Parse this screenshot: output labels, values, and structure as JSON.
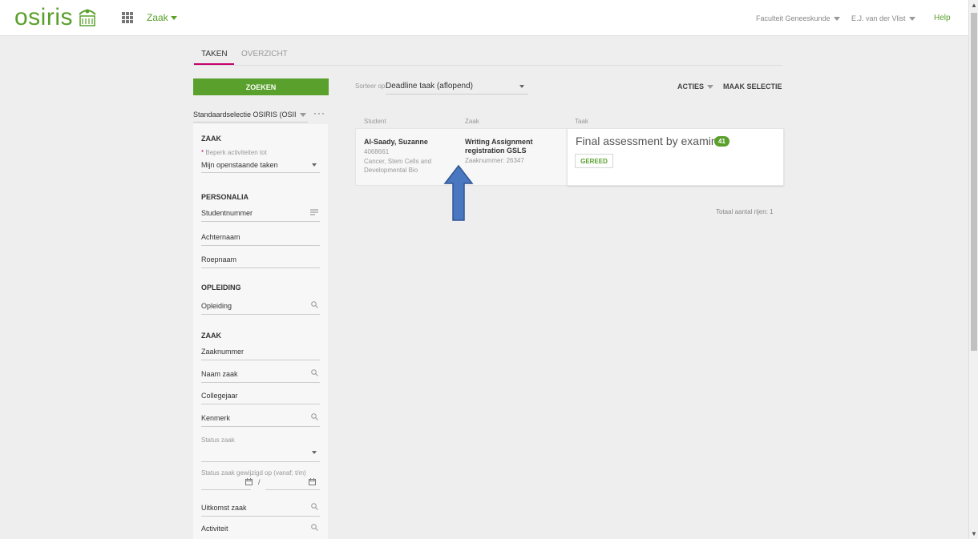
{
  "header": {
    "logo_text": "osiris",
    "menu_label": "Zaak",
    "faculty": "Faculteit Geneeskunde",
    "user": "E.J. van der Vlist",
    "help": "Help"
  },
  "tabs": [
    {
      "label": "TAKEN",
      "active": true
    },
    {
      "label": "OVERZICHT",
      "active": false
    }
  ],
  "sidebar": {
    "search_button": "ZOEKEN",
    "selection": "Standaardselectie OSIRIS (OSII",
    "more": "···",
    "zaak_section": "ZAAK",
    "limit_label": "Beperk activiteiten tot",
    "limit_required": "*",
    "limit_value": "Mijn openstaande taken",
    "personalia_section": "PERSONALIA",
    "studentnummer": "Studentnummer",
    "achternaam": "Achternaam",
    "roepnaam": "Roepnaam",
    "opleiding_section": "OPLEIDING",
    "opleiding": "Opleiding",
    "zaak_section2": "ZAAK",
    "zaaknummer": "Zaaknummer",
    "naam_zaak": "Naam zaak",
    "collegejaar": "Collegejaar",
    "kenmerk": "Kenmerk",
    "status_zaak": "Status zaak",
    "status_gewijzigd": "Status zaak gewijzigd op (vanaf; t/m)",
    "date_separator": "/",
    "uitkomst_zaak": "Uitkomst zaak",
    "activiteit": "Activiteit"
  },
  "main": {
    "sort_label": "Sorteer op:",
    "sort_value": "Deadline taak (aflopend)",
    "acties": "ACTIES",
    "maak_selectie": "MAAK SELECTIE",
    "columns": [
      "Student",
      "Zaak",
      "Taak"
    ],
    "row": {
      "student_name": "Al-Saady, Suzanne",
      "student_number": "4068661",
      "student_program": "Cancer, Stem Cells and Developmental Bio",
      "zaak_title": "Writing Assignment registration GSLS",
      "zaak_number": "Zaaknummer: 26347",
      "taak_title": "Final assessment by examiner",
      "taak_badge": "41",
      "taak_button": "GEREED"
    },
    "total_rows": "Totaal aantal rijen: 1"
  },
  "colors": {
    "brand_green": "#5aa02c",
    "accent_magenta": "#c6006f",
    "arrow_blue": "#4a78c0"
  }
}
